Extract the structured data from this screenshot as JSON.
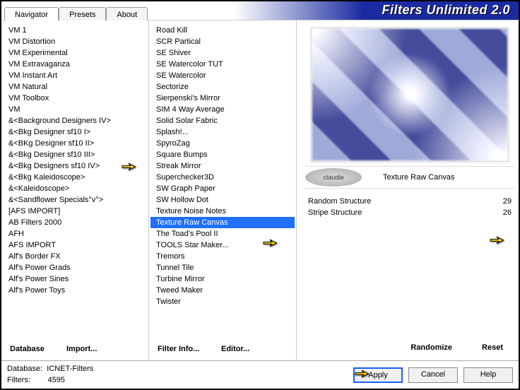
{
  "app_title": "Filters Unlimited 2.0",
  "tabs": [
    "Navigator",
    "Presets",
    "About"
  ],
  "active_tab": 0,
  "left": {
    "items": [
      "VM 1",
      "VM Distortion",
      "VM Experimental",
      "VM Extravaganza",
      "VM Instant Art",
      "VM Natural",
      "VM Toolbox",
      "VM",
      "&<Background Designers IV>",
      "&<Bkg Designer sf10 I>",
      "&<BKg Designer sf10 II>",
      "&<Bkg Designer sf10 III>",
      "&<Bkg Designers sf10 IV>",
      "&<Bkg Kaleidoscope>",
      "&<Kaleidoscope>",
      "&<Sandflower Specials°v°>",
      "[AFS IMPORT]",
      "AB Filters 2000",
      "AFH",
      "AFS IMPORT",
      "Alf's Border FX",
      "Alf's Power Grads",
      "Alf's Power Sines",
      "Alf's Power Toys"
    ],
    "selected_index": 11,
    "buttons": [
      "Database",
      "Import..."
    ]
  },
  "mid": {
    "items": [
      "Road Kill",
      "SCR  Partical",
      "SE Shiver",
      "SE Watercolor TUT",
      "SE Watercolor",
      "Sectorize",
      "Sierpenski's Mirror",
      "SIM 4 Way Average",
      "Solid Solar Fabric",
      "Splash!...",
      "SpyroZag",
      "Square Bumps",
      "Streak Mirror",
      "Superchecker3D",
      "SW Graph Paper",
      "SW Hollow Dot",
      "Texture Noise Notes",
      "Texture Raw Canvas",
      "The Toad's Pool II",
      "TOOLS Star Maker...",
      "Tremors",
      "Tunnel Tile",
      "Turbine Mirror",
      "Tweed Maker",
      "Twister"
    ],
    "selected_index": 17,
    "buttons": [
      "Filter Info...",
      "Editor..."
    ]
  },
  "right": {
    "claudia": "claudia",
    "filter_label": "Texture Raw Canvas",
    "params": [
      {
        "name": "Random Structure",
        "value": "29"
      },
      {
        "name": "Stripe Structure",
        "value": "26"
      }
    ],
    "buttons": [
      "Randomize",
      "Reset"
    ]
  },
  "footer": {
    "db_label": "Database:",
    "db_value": "ICNET-Filters",
    "filters_label": "Filters:",
    "filters_value": "4595",
    "buttons": [
      "Apply",
      "Cancel",
      "Help"
    ]
  }
}
